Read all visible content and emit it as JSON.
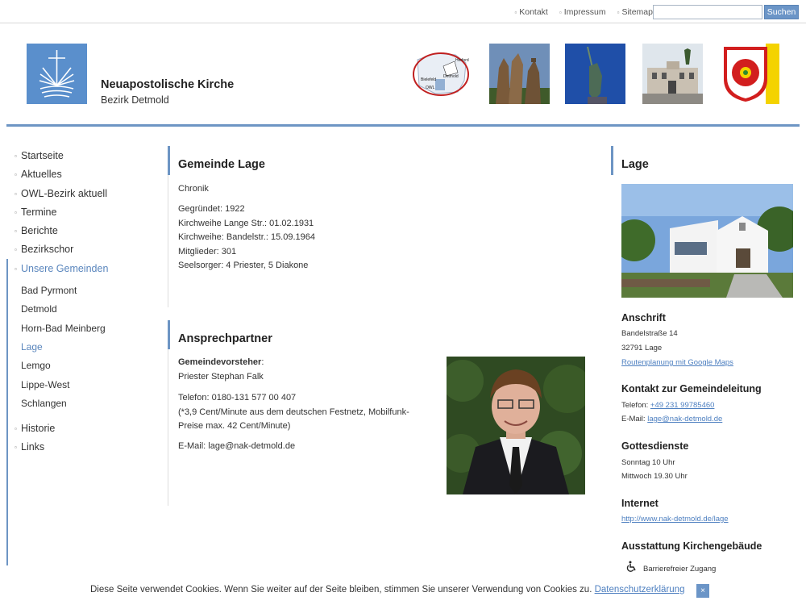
{
  "topbar": {
    "links": [
      "Kontakt",
      "Impressum",
      "Sitemap"
    ],
    "search_placeholder": "",
    "search_button": "Suchen"
  },
  "header": {
    "title": "Neuapostolische Kirche",
    "subtitle": "Bezirk Detmold",
    "map_labels": {
      "herford": "Herford",
      "detmold": "Detmold",
      "bielefeld": "Bielefeld",
      "owl": "OWL"
    }
  },
  "nav": {
    "items_top": [
      "Startseite",
      "Aktuelles",
      "OWL-Bezirk aktuell",
      "Termine",
      "Berichte",
      "Bezirkschor"
    ],
    "active_group": "Unsere Gemeinden",
    "sub_items": [
      "Bad Pyrmont",
      "Detmold",
      "Horn-Bad Meinberg",
      "Lage",
      "Lemgo",
      "Lippe-West",
      "Schlangen"
    ],
    "active_sub": "Lage",
    "items_bottom": [
      "Historie",
      "Links"
    ]
  },
  "main": {
    "title": "Gemeinde Lage",
    "chronik_label": "Chronik",
    "facts": [
      "Gegründet: 1922",
      "Kirchweihe Lange Str.: 01.02.1931",
      "Kirchweihe: Bandelstr.: 15.09.1964",
      "Mitglieder: 301",
      "Seelsorger: 4 Priester, 5 Diakone"
    ],
    "contact_title": "Ansprechpartner",
    "leader_label": "Gemeindevorsteher",
    "leader_colon": ":",
    "leader_name": "Priester Stephan Falk",
    "phone": "Telefon: 0180-131 577 00 407",
    "phone_note_1": "(*3,9 Cent/Minute aus dem deutschen Festnetz, Mobilfunk-",
    "phone_note_2": "Preise max. 42 Cent/Minute)",
    "email": "E-Mail: lage@nak-detmold.de"
  },
  "sidebar": {
    "title": "Lage",
    "address_title": "Anschrift",
    "street": "Bandelstraße 14",
    "city": "32791 Lage",
    "route_link": "Routenplanung mit Google Maps",
    "contact_title": "Kontakt zur Gemeindeleitung",
    "phone_label": "Telefon: ",
    "phone_number": "+49 231 99785460",
    "email_label": "E-Mail: ",
    "email_address": "lage@nak-detmold.de",
    "services_title": "Gottesdienste",
    "service_1": "Sonntag 10 Uhr",
    "service_2": "Mittwoch 19.30 Uhr",
    "internet_title": "Internet",
    "internet_link": "http://www.nak-detmold.de/lage",
    "equipment_title": "Ausstattung Kirchengebäude",
    "equipment_item": "Barrierefreier Zugang"
  },
  "cookie": {
    "text": "Diese Seite verwendet Cookies. Wenn Sie weiter auf der Seite bleiben, stimmen Sie unserer Verwendung von Cookies zu. ",
    "link": "Datenschutzerklärung",
    "close": "×"
  },
  "colors": {
    "accent": "#6d95c4",
    "link": "#4d7fc0",
    "logo_bg": "#5a8fcc"
  }
}
